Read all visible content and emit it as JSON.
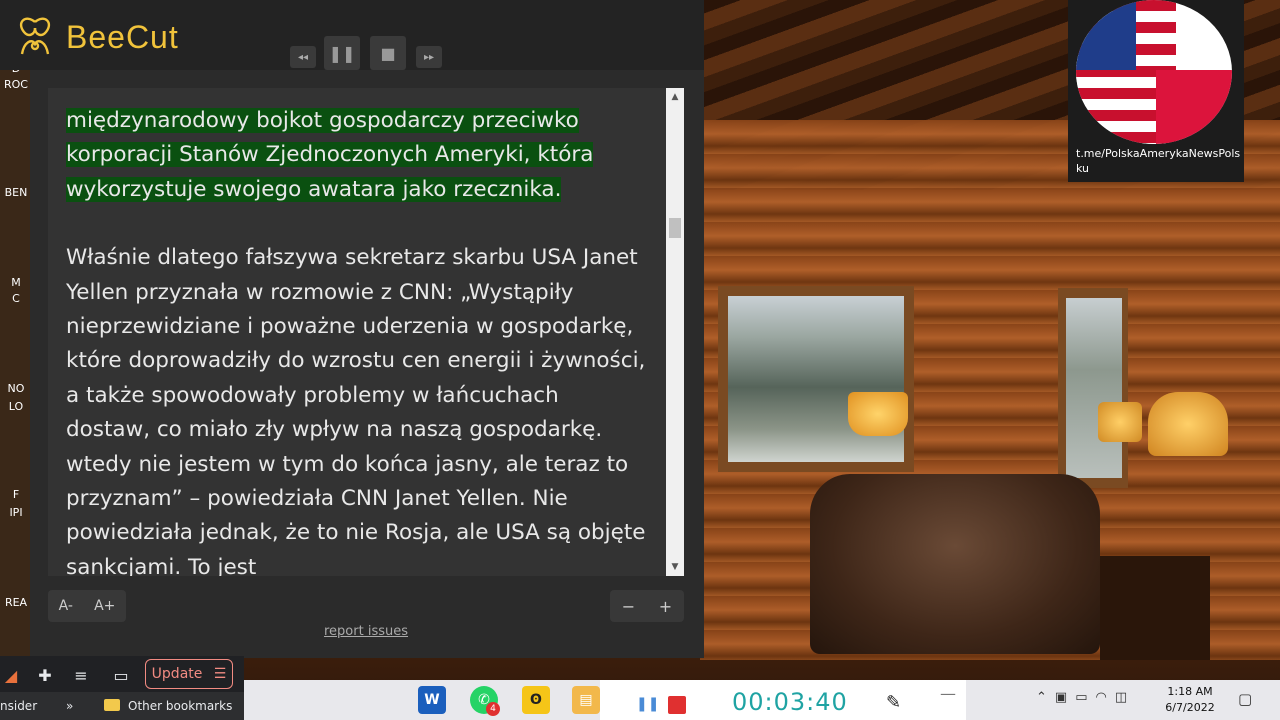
{
  "app": {
    "name": "BeeCut",
    "brand_color": "#f1c33b"
  },
  "playback": {
    "rewind_icon": "rewind-icon",
    "pause_icon": "pause-icon",
    "stop_icon": "stop-icon",
    "forward_icon": "forward-icon"
  },
  "reader": {
    "highlighted_paragraph": "międzynarodowy bojkot gospodarczy przeciwko korporacji Stanów Zjednoczonych Ameryki, która wykorzystuje swojego awatara jako rzecznika.",
    "paragraph_2": "Właśnie dlatego fałszywa sekretarz skarbu USA Janet Yellen przyznała w rozmowie z CNN: „Wystąpiły nieprzewidziane i poważne uderzenia w gospodarkę, które doprowadziły do wzrostu cen energii i żywności, a także spowodowały problemy w łańcuchach dostaw, co miało zły wpływ na naszą gospodarkę. wtedy nie jestem w tym do końca jasny, ale teraz to przyznam” – powiedziała CNN Janet Yellen. Nie powiedziała jednak, że to nie Rosja, ale USA są objęte sankcjami. To jest",
    "highlight_color": "#0a5010",
    "font_decrease_label": "A-",
    "font_increase_label": "A+",
    "zoom_out_label": "−",
    "zoom_in_label": "+",
    "report_link": "report issues"
  },
  "desktop_labels": [
    "D",
    "ROC",
    "BEN",
    "M",
    "C",
    "NO",
    "LO",
    "F",
    "IPI",
    "REA"
  ],
  "flag_badge": {
    "caption": "t.me/PolskaAmerykaNewsPolsku"
  },
  "browser": {
    "update_label": "Update",
    "bookmark_left": "nsider",
    "bookmark_chevron": "»",
    "bookmark_folder": "Other bookmarks"
  },
  "taskbar": {
    "whatsapp_badge": "4",
    "recording_time": "00:03:40",
    "clock_time": "1:18 AM",
    "clock_date": "6/7/2022"
  }
}
